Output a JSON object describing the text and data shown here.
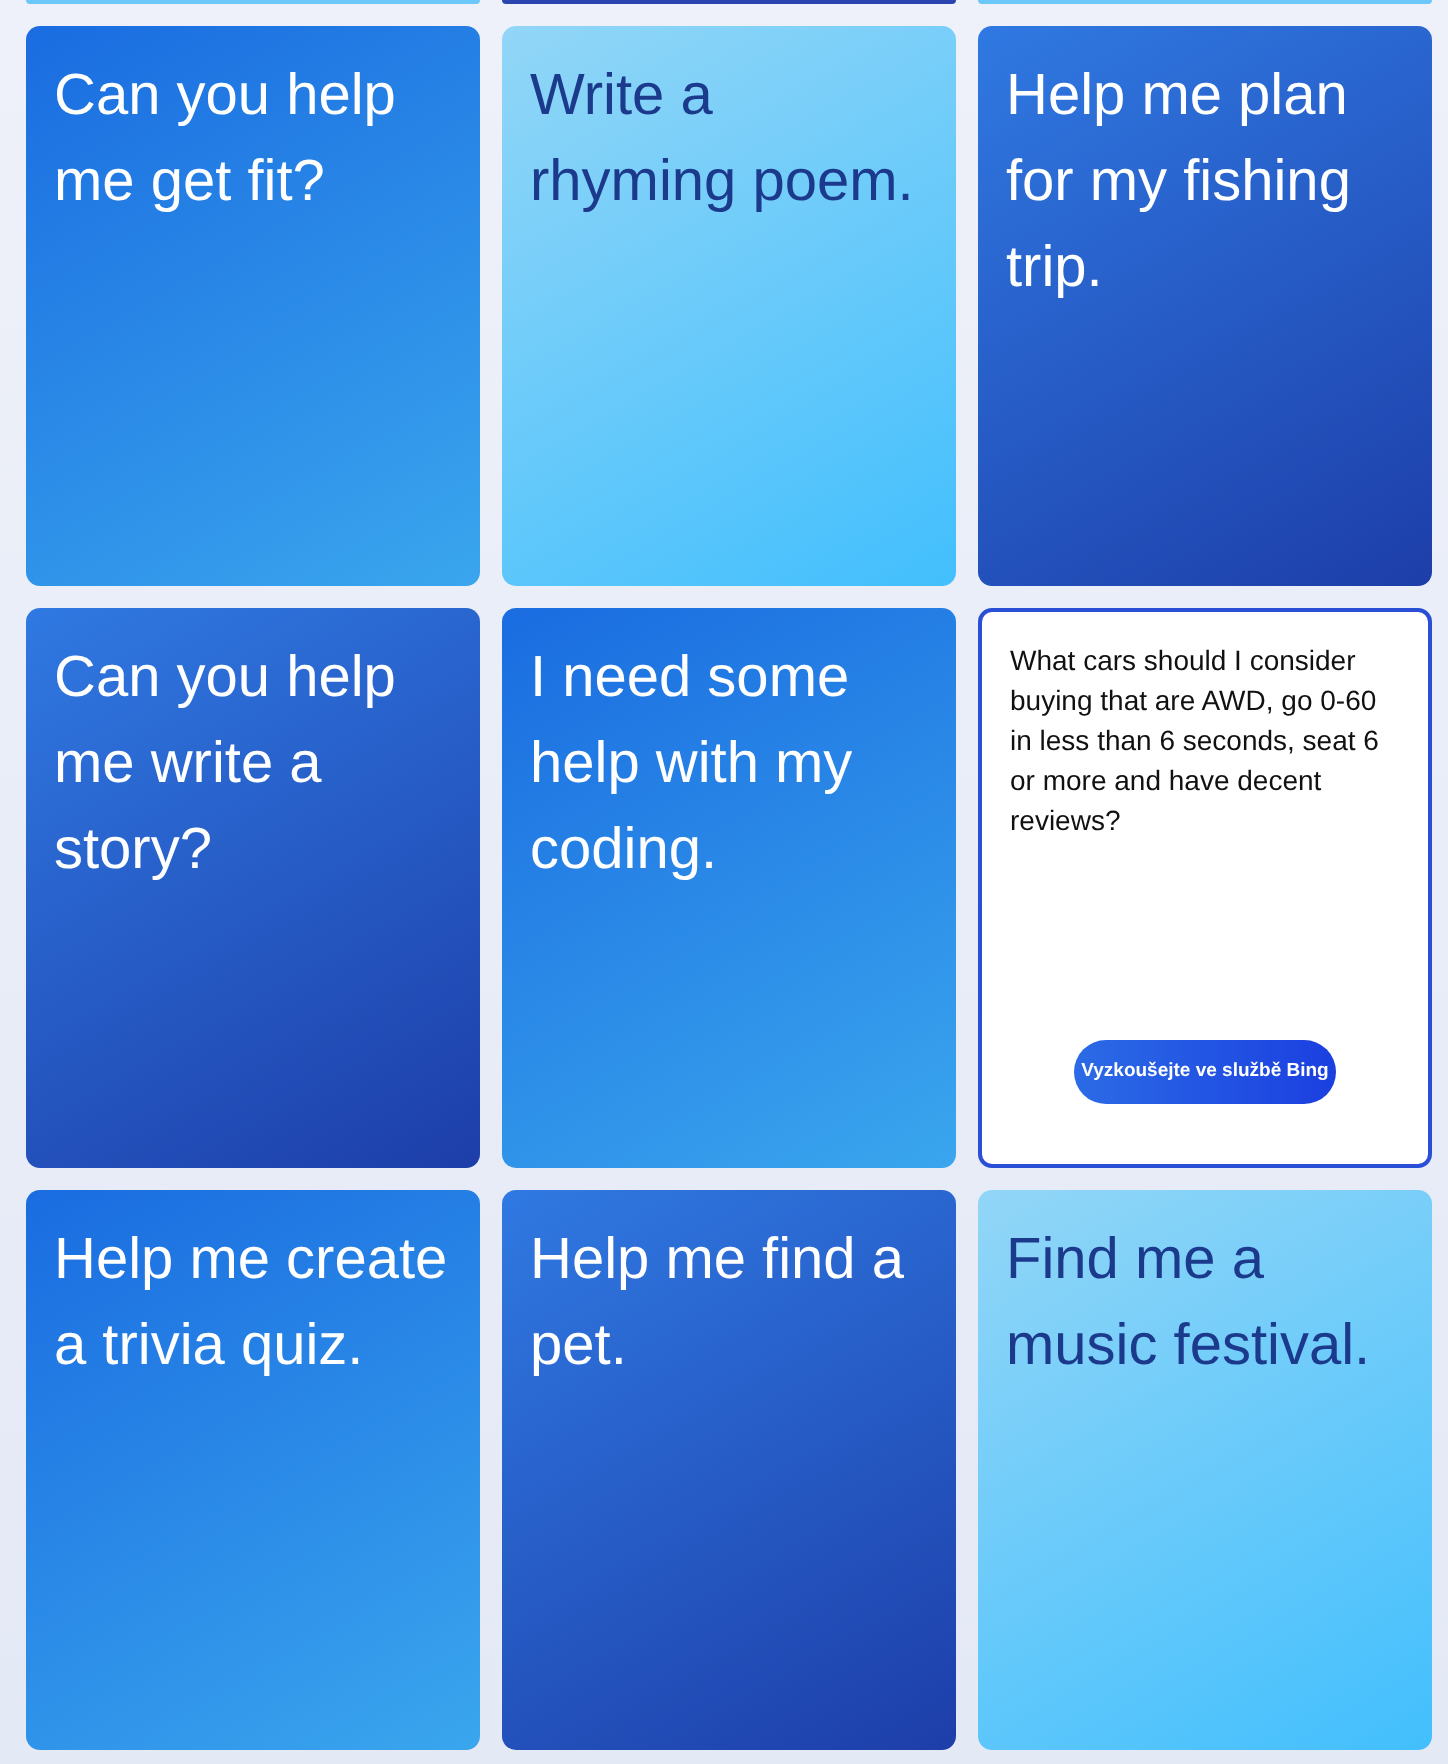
{
  "top_edges": [
    {
      "color": "#6cc8f8"
    },
    {
      "color": "#2a45b0"
    },
    {
      "color": "#6cc8f8"
    }
  ],
  "cards": [
    {
      "kind": "bright",
      "text": "Can you help me get fit?"
    },
    {
      "kind": "light",
      "text": "Write a rhyming poem."
    },
    {
      "kind": "deep",
      "text": "Help me plan for my fishing trip."
    },
    {
      "kind": "deep",
      "text": "Can you help me write a story?"
    },
    {
      "kind": "bright",
      "text": "I need some help with my coding."
    },
    {
      "kind": "detail",
      "text": "What cars should I consider buying that are AWD, go 0-60 in less than 6 seconds, seat 6 or more and have decent reviews?",
      "button": "Vyzkoušejte ve službě Bing"
    },
    {
      "kind": "bright",
      "text": "Help me create a trivia quiz."
    },
    {
      "kind": "deep",
      "text": "Help me find a pet."
    },
    {
      "kind": "light",
      "text": "Find me a music festival."
    }
  ]
}
